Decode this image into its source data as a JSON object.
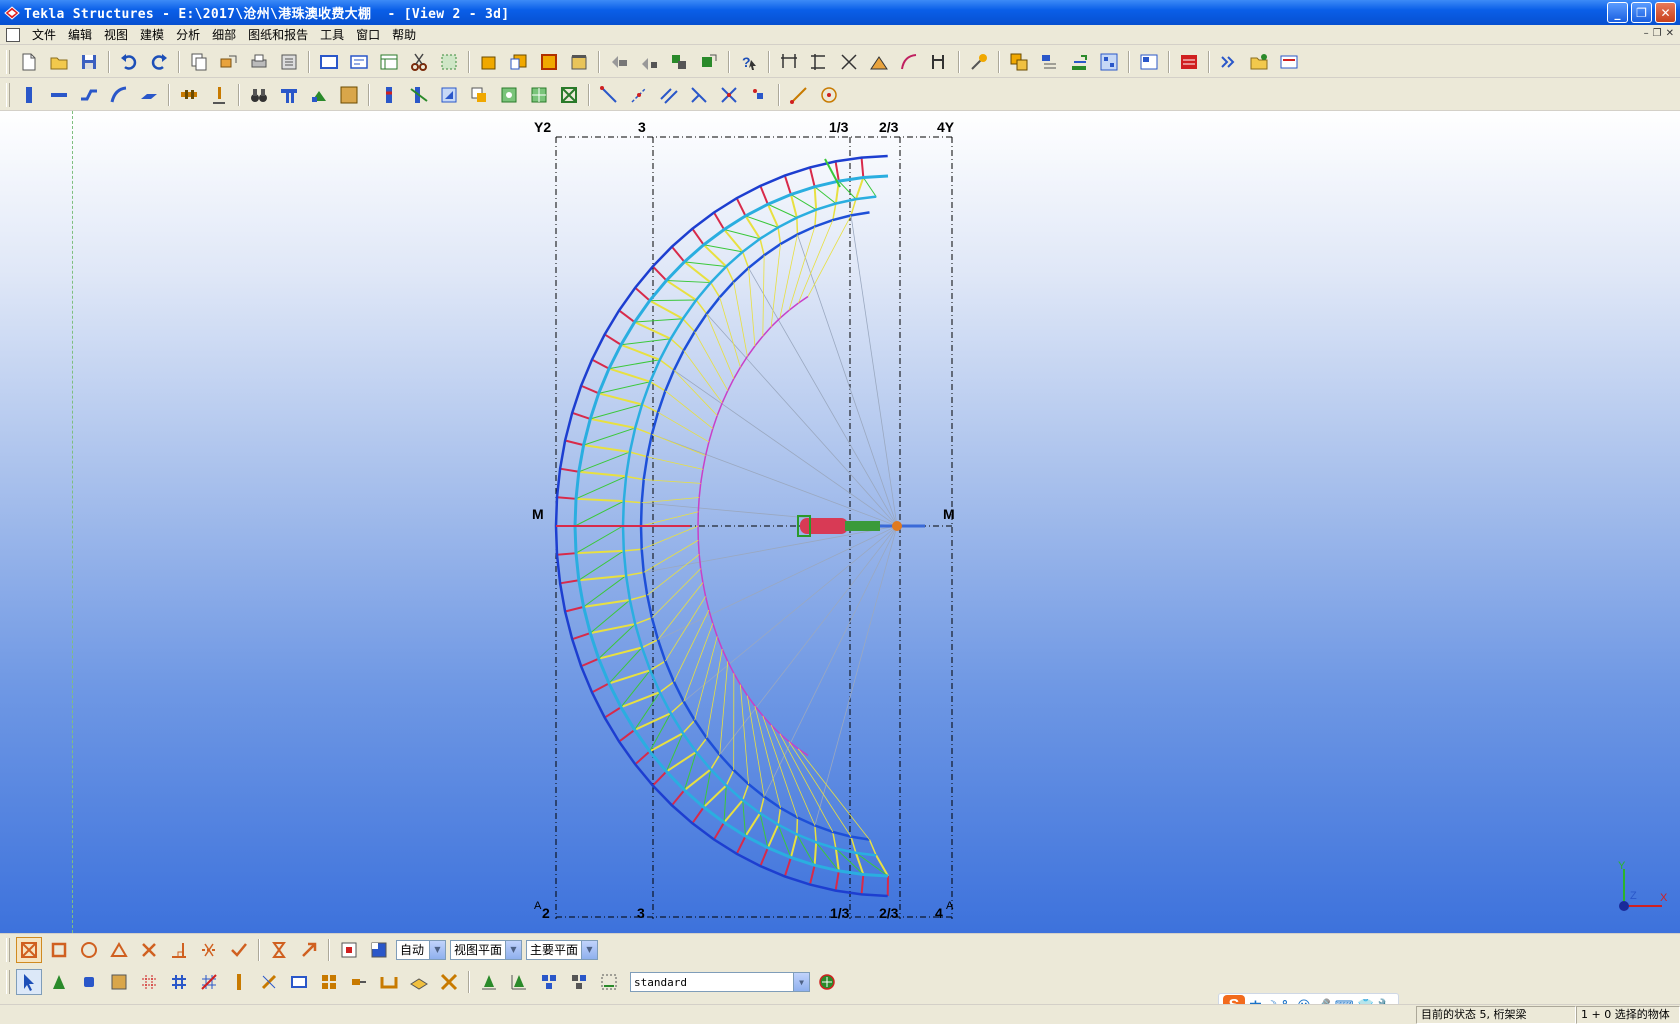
{
  "window": {
    "title": "Tekla Structures - E:\\2017\\沧州\\港珠澳收费大棚  - [View 2 - 3d]",
    "controls": {
      "minimize": "_",
      "restore": "❐",
      "close": "✕"
    }
  },
  "menubar": {
    "items": [
      "文件",
      "编辑",
      "视图",
      "建模",
      "分析",
      "细部",
      "图纸和报告",
      "工具",
      "窗口",
      "帮助"
    ],
    "mdi_controls": [
      "–",
      "❐",
      "✕"
    ]
  },
  "viewport": {
    "grid_labels_top": [
      "Y2",
      "3",
      "1/3",
      "2/3",
      "4Y"
    ],
    "grid_labels_bottom": [
      "2",
      "3",
      "1/3",
      "2/3",
      "4"
    ],
    "grid_label_left": "M",
    "grid_label_right": "M",
    "corner_label_left": "A",
    "corner_label_right": "A",
    "axes": {
      "x": "X",
      "y": "Y",
      "z": "Z"
    }
  },
  "bottom_toolbar": {
    "snap_mode": "自动",
    "plane_1": "视图平面",
    "plane_2": "主要平面",
    "selection_filter": "standard"
  },
  "ime": {
    "items": [
      "中",
      "☽",
      "°,",
      "☺",
      "🎤",
      "⌨",
      "👕",
      "🔧"
    ]
  },
  "statusbar": {
    "state": "目前的状态 5, 桁架梁",
    "selection": "1 + 0 选择的物体"
  }
}
